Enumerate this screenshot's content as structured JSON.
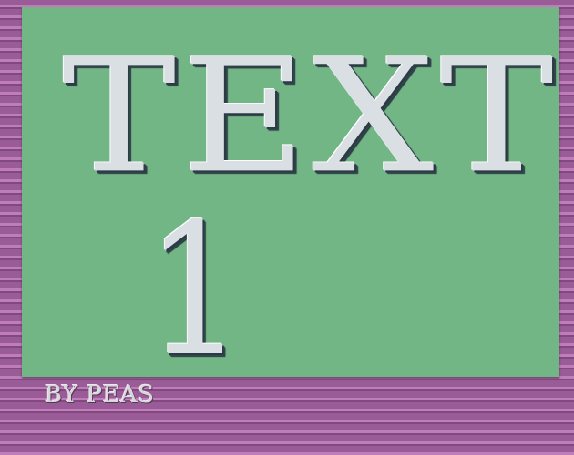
{
  "panel": {
    "heading": "TEXT",
    "number": "1"
  },
  "footer": {
    "credit": "BY PEAS"
  },
  "colors": {
    "panel_background": "#72b685",
    "stripe_base": "#9a5c96",
    "stripe_light": "#c07dbb",
    "stripe_dark": "#844880",
    "lettering": "#d9dfe3",
    "lettering_shadow": "#2b3b44"
  }
}
